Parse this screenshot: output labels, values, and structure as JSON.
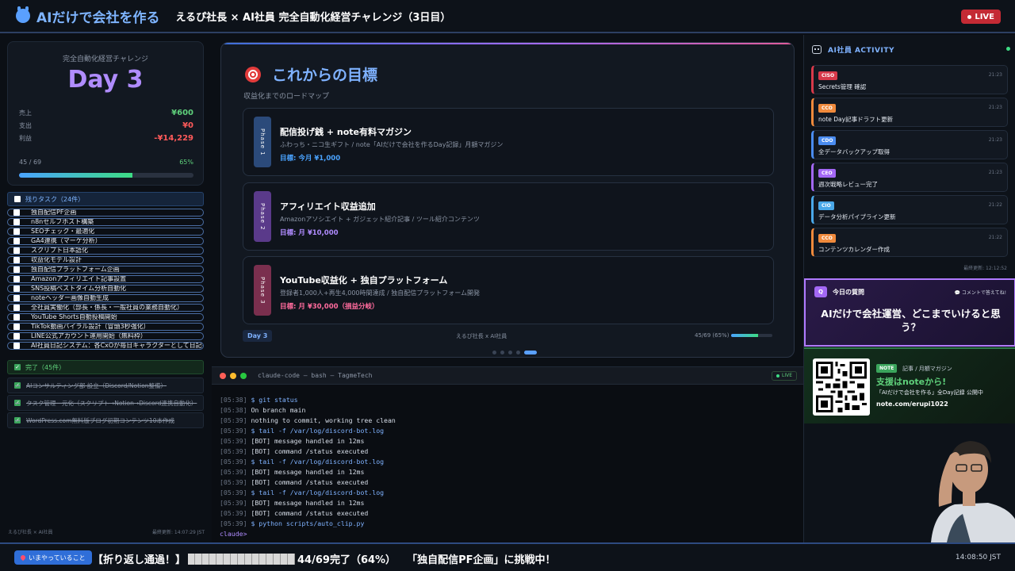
{
  "header": {
    "logo": "AIだけで会社を作る",
    "title": "えるぴ社長 × AI社員 完全自動化経営チャレンジ（3日目）",
    "live": "LIVE"
  },
  "stats": {
    "challenge_label": "完全自動化経営チャレンジ",
    "day": "Day 3",
    "rows": [
      {
        "label": "売上",
        "value": "¥600",
        "color": "#5fd07b"
      },
      {
        "label": "支出",
        "value": "¥0",
        "color": "#ff5a5a"
      },
      {
        "label": "利益",
        "value": "-¥14,229",
        "color": "#ff5a5a"
      }
    ],
    "progress_text": "45 / 69",
    "progress_pct": "65%",
    "progress_fraction": 0.65
  },
  "tasks": {
    "header": "残りタスク（24件）",
    "items": [
      "独自配信PF企画",
      "n8nセルフホスト構築",
      "SEOチェック・最適化",
      "GA4連携（マーケ分析）",
      "スクリプト日本語化",
      "収益化モデル設計",
      "独自配信プラットフォーム企画",
      "Amazonアフィリエイト記事設置",
      "SNS投稿ベストタイム分析自動化",
      "noteヘッダー画像自動生成",
      "全社員実働化（部長・係長・一般社員の業務自動化）",
      "YouTube Shorts自動投稿開始",
      "TikTok動画バイラル設計（冒頭3秒強化）",
      "LINE公式アカウント運用開始（無料枠）",
      "AI社員日記システム：各CxOが毎日キャラクターとして日記を自動..."
    ]
  },
  "done": {
    "header": "完了（45件）",
    "items": [
      "AIコンサルティング部 設立（Discord/Notion整備）",
      "タスク管理一元化（スクリプト→Notion→Discord連携自動化）",
      "WordPress.com無料版ブログ初期コンテンツ10本作成"
    ]
  },
  "left_footer": {
    "left": "えるぴ社長 × AI社員",
    "right": "最終更新: 14:07:29 JST"
  },
  "roadmap": {
    "title": "これからの目標",
    "subtitle": "収益化までのロードマップ",
    "phases": [
      {
        "tag": "Phase 1",
        "title": "配信投げ銭 + note有料マガジン",
        "desc": "ふわっち・ニコ生ギフト / note「AIだけで会社を作るDay記録」月額マガジン",
        "goal": "目標: 今月 ¥1,000",
        "color": "#2b4a7a",
        "goal_color": "#4aa3ff"
      },
      {
        "tag": "Phase 2",
        "title": "アフィリエイト収益追加",
        "desc": "Amazonアソシエイト + ガジェット紹介記事 / ツール紹介コンテンツ",
        "goal": "目標: 月 ¥10,000",
        "color": "#5a3a8a",
        "goal_color": "#b08cff"
      },
      {
        "tag": "Phase 3",
        "title": "YouTube収益化 + 独自プラットフォーム",
        "desc": "登録者1,000人+再生4,000時間達成 / 独自配信プラットフォーム開発",
        "goal": "目標: 月 ¥30,000（損益分岐）",
        "color": "#7a2f4e",
        "goal_color": "#ff6b9d"
      }
    ],
    "footer_day": "Day 3",
    "footer_mid": "えるぴ社長 x AI社員",
    "footer_right": "45/69 (65%)",
    "footer_fraction": 0.65,
    "active_dot": 4,
    "dot_count": 5
  },
  "terminal": {
    "title": "claude-code — bash — TagmeTech",
    "live": "LIVE",
    "lines": [
      {
        "ts": "[05:38]",
        "text": "$ git status",
        "kind": "cmd"
      },
      {
        "ts": "[05:38]",
        "text": "On branch main",
        "kind": "out"
      },
      {
        "ts": "[05:39]",
        "text": "nothing to commit, working tree clean",
        "kind": "out"
      },
      {
        "ts": "[05:39]",
        "text": "$ tail -f /var/log/discord-bot.log",
        "kind": "cmd"
      },
      {
        "ts": "[05:39]",
        "text": "[BOT] message handled in 12ms",
        "kind": "out"
      },
      {
        "ts": "[05:39]",
        "text": "[BOT] command /status executed",
        "kind": "out"
      },
      {
        "ts": "[05:39]",
        "text": "$ tail -f /var/log/discord-bot.log",
        "kind": "cmd"
      },
      {
        "ts": "[05:39]",
        "text": "[BOT] message handled in 12ms",
        "kind": "out"
      },
      {
        "ts": "[05:39]",
        "text": "[BOT] command /status executed",
        "kind": "out"
      },
      {
        "ts": "[05:39]",
        "text": "$ tail -f /var/log/discord-bot.log",
        "kind": "cmd"
      },
      {
        "ts": "[05:39]",
        "text": "[BOT] message handled in 12ms",
        "kind": "out"
      },
      {
        "ts": "[05:39]",
        "text": "[BOT] command /status executed",
        "kind": "out"
      },
      {
        "ts": "[05:39]",
        "text": "$ python scripts/auto_clip.py",
        "kind": "cmd"
      }
    ],
    "prompt": "claude>"
  },
  "activity": {
    "title": "AI社員 ACTIVITY",
    "items": [
      {
        "role": "CISO",
        "time": "21:23",
        "msg": "Secrets管理 確認",
        "color": "#d8394a"
      },
      {
        "role": "CCO",
        "time": "21:23",
        "msg": "note Day記事ドラフト更新",
        "color": "#f08a3c"
      },
      {
        "role": "CDO",
        "time": "21:23",
        "msg": "全データバックアップ取得",
        "color": "#4a8cf0"
      },
      {
        "role": "CEO",
        "time": "21:23",
        "msg": "週次戦略レビュー完了",
        "color": "#a368f5"
      },
      {
        "role": "CIO",
        "time": "21:22",
        "msg": "データ分析パイプライン更新",
        "color": "#4aa8e8"
      },
      {
        "role": "CCO",
        "time": "21:22",
        "msg": "コンテンツカレンダー作成",
        "color": "#f08a3c"
      }
    ],
    "updated": "最終更新: 12:12:52"
  },
  "question": {
    "badge": "Q",
    "title": "今日の質問",
    "note": "💬 コメントで答えてね!",
    "text": "AIだけで会社運営、どこまでいけると思う？"
  },
  "note_box": {
    "badge": "NOTE",
    "label": "記事 / 月額マガジン",
    "title": "支援はnoteから!",
    "sub": "「AIだけで会社を作る」全Day記録 公開中",
    "url": "note.com/erupi1022"
  },
  "bottom": {
    "now_label": "いまやっていること",
    "ticker_prefix": "【折り返し通過！】",
    "ticker_progress": "44/69完了（64%）",
    "ticker_suffix": "「独自配信PF企画」に挑戦中！",
    "clock": "14:08:50 JST"
  }
}
